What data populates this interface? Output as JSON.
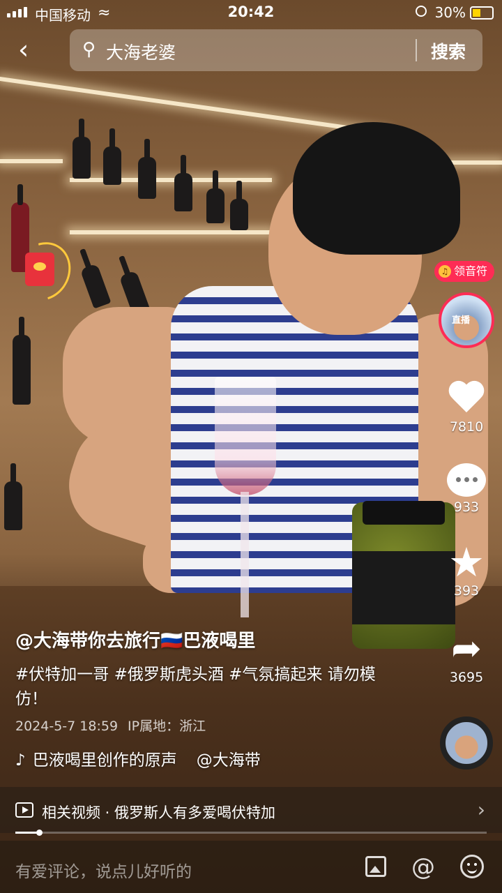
{
  "status_bar": {
    "carrier": "中国移动",
    "time": "20:42",
    "battery": "30%"
  },
  "search": {
    "query": "大海老婆",
    "button": "搜索"
  },
  "side": {
    "badge": "领音符",
    "live_label": "直播",
    "likes": "7810",
    "comments": "933",
    "favorites": "393",
    "shares": "3695"
  },
  "video": {
    "author": "@大海带你去旅行🇷🇺巴液喝里",
    "description": "#伏特加一哥 #俄罗斯虎头酒 #气氛搞起来 请勿模仿！",
    "date": "2024-5-7 18:59",
    "ip": "IP属地：浙江",
    "music_title": "巴液喝里创作的原声",
    "music_author": "@大海带",
    "progress": 0.05
  },
  "related": {
    "text": "相关视频 · 俄罗斯人有多爱喝伏特加"
  },
  "comment_bar": {
    "placeholder": "有爱评论，说点儿好听的"
  },
  "colors": {
    "accent": "#fe2c55",
    "gold": "#ffc93c"
  }
}
